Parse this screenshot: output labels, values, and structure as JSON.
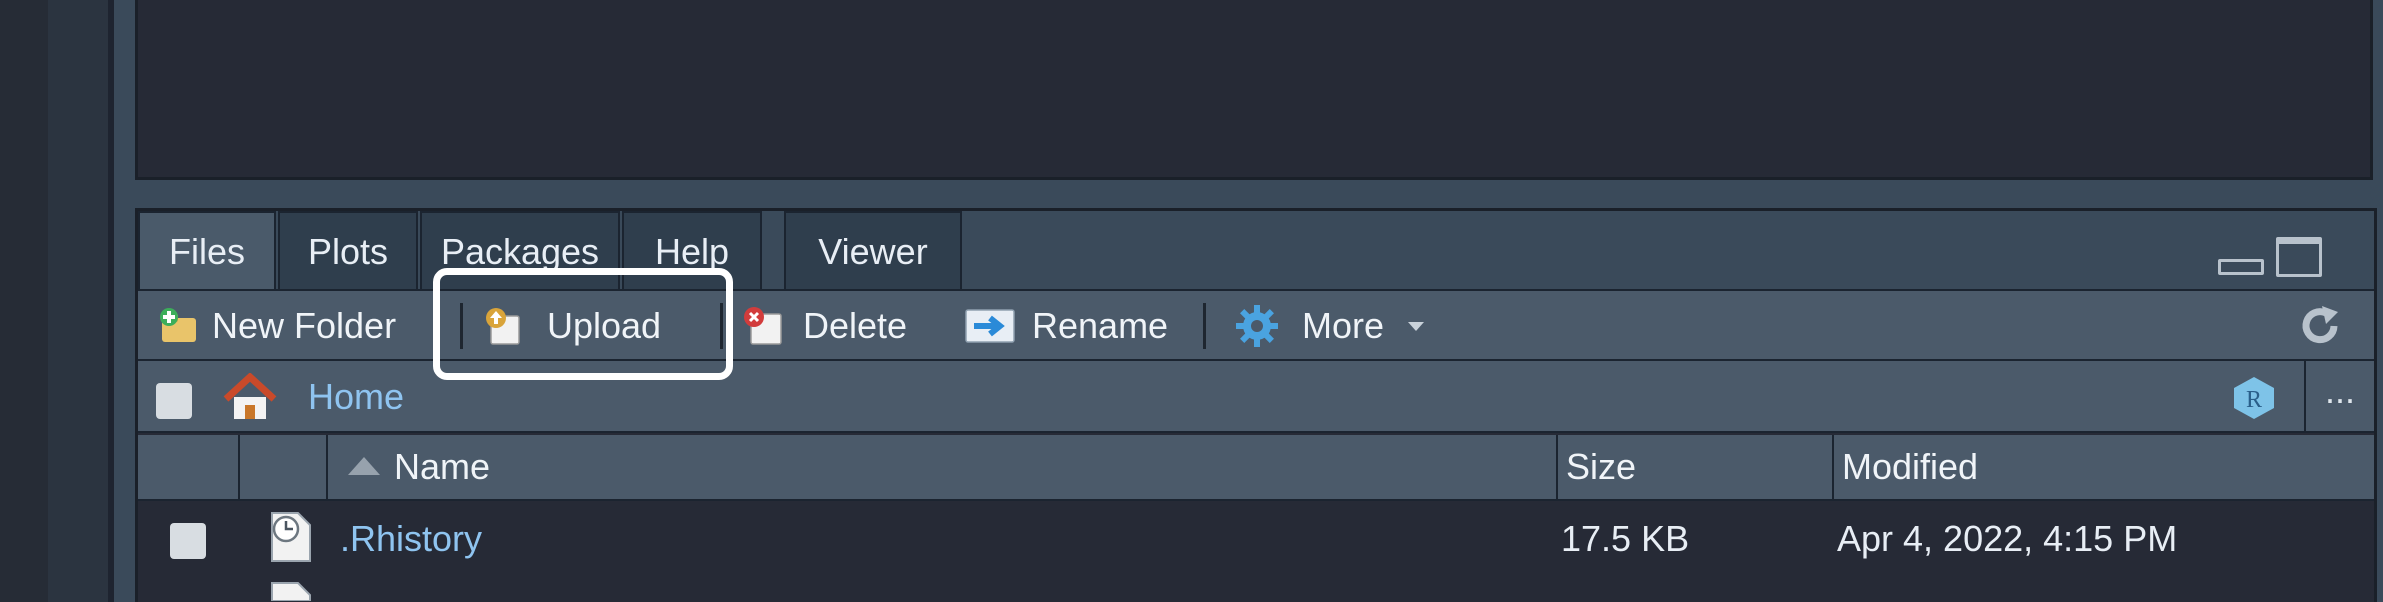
{
  "tabs": [
    {
      "label": "Files"
    },
    {
      "label": "Plots"
    },
    {
      "label": "Packages"
    },
    {
      "label": "Help"
    },
    {
      "label": "Viewer"
    }
  ],
  "toolbar": {
    "new_folder_label": "New Folder",
    "upload_label": "Upload",
    "delete_label": "Delete",
    "rename_label": "Rename",
    "more_label": "More"
  },
  "path": {
    "home_label": "Home",
    "ellipsis": "..."
  },
  "columns": {
    "name": "Name",
    "size": "Size",
    "modified": "Modified"
  },
  "files": [
    {
      "name": ".Rhistory",
      "size": "17.5 KB",
      "modified": "Apr 4, 2022, 4:15 PM"
    }
  ],
  "icons": {
    "new_folder": "new-folder-icon",
    "upload": "upload-icon",
    "delete": "delete-icon",
    "rename": "rename-icon",
    "more": "gear-icon",
    "refresh": "refresh-icon",
    "home": "home-icon",
    "project": "r-project-icon"
  },
  "colors": {
    "accent_link": "#8fc4f0",
    "highlight_border": "#ffffff"
  }
}
